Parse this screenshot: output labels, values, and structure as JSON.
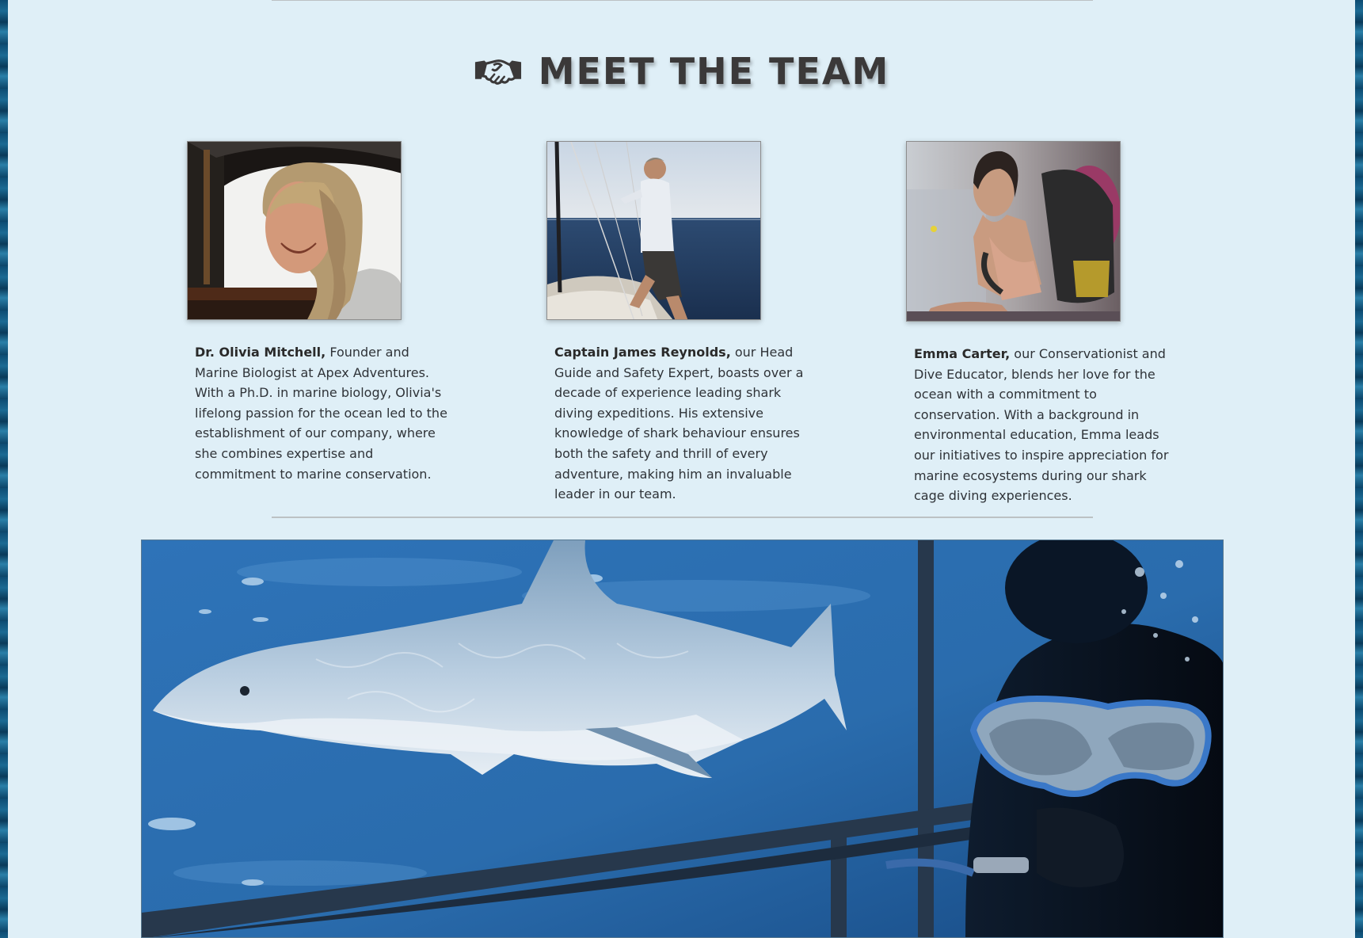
{
  "section": {
    "heading": "MEET THE TEAM",
    "heading_icon": "handshake-icon"
  },
  "team": [
    {
      "name": "Dr. Olivia Mitchell,",
      "description": "Founder and Marine Biologist at Apex Adventures. With a Ph.D. in marine biology, Olivia's lifelong passion for the ocean led to the establishment of our company, where she combines expertise and commitment to marine conservation.",
      "photo": "photo of Dr. Olivia Mitchell laughing aboard a boat"
    },
    {
      "name": "Captain James Reynolds,",
      "description": "our Head Guide and Safety Expert, boasts over a decade of experience leading shark diving expeditions. His extensive knowledge of shark behaviour ensures both the safety and thrill of every adventure, making him an invaluable leader in our team.",
      "photo": "photo of Captain James Reynolds on the bow of a sailboat"
    },
    {
      "name": "Emma Carter,",
      "description": "our Conservationist and Dive Educator, blends her love for the ocean with a commitment to conservation. With a background in environmental education, Emma leads our initiatives to inspire appreciation for marine ecosystems during our shark cage diving experiences.",
      "photo": "photo of Emma Carter wearing scuba gear"
    }
  ],
  "hero_image": "great white shark swimming past a diver in a shark cage",
  "colors": {
    "page_background": "#dfeff7",
    "heading_text": "#3b3939",
    "body_text": "#2f3338",
    "divider": "#bcc1c4"
  }
}
